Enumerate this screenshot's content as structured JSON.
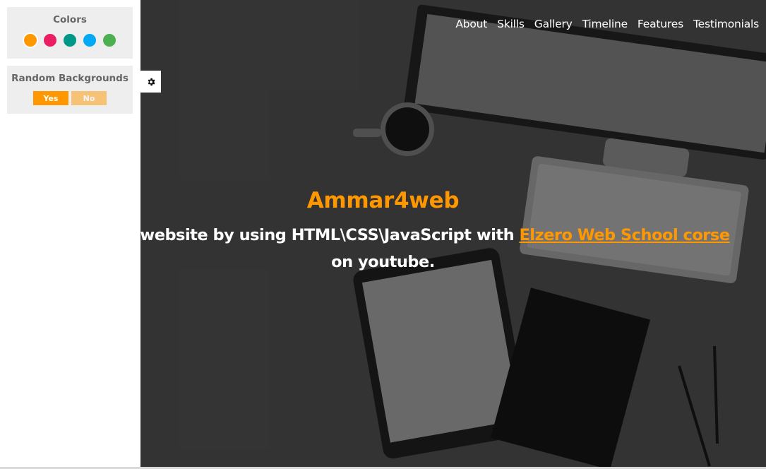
{
  "settings": {
    "colors_title": "Colors",
    "colors": [
      "#ff9800",
      "#e91e63",
      "#009688",
      "#03a9f4",
      "#4caf50"
    ],
    "active_color": "#ff9800",
    "random_title": "Random Backgrounds",
    "yes_label": "Yes",
    "no_label": "No",
    "gear_icon": "gear-icon"
  },
  "nav": {
    "items": [
      "About",
      "Skills",
      "Gallery",
      "Timeline",
      "Features",
      "Testimonials"
    ]
  },
  "intro": {
    "title": "Ammar4web",
    "text_before": "his website by using HTML\\CSS\\JavaScript with ",
    "link_text": "Elzero Web School corse",
    "text_after": "on youtube."
  },
  "theme": {
    "accent": "#ff9800",
    "panel_bg": "#eeeeee"
  }
}
